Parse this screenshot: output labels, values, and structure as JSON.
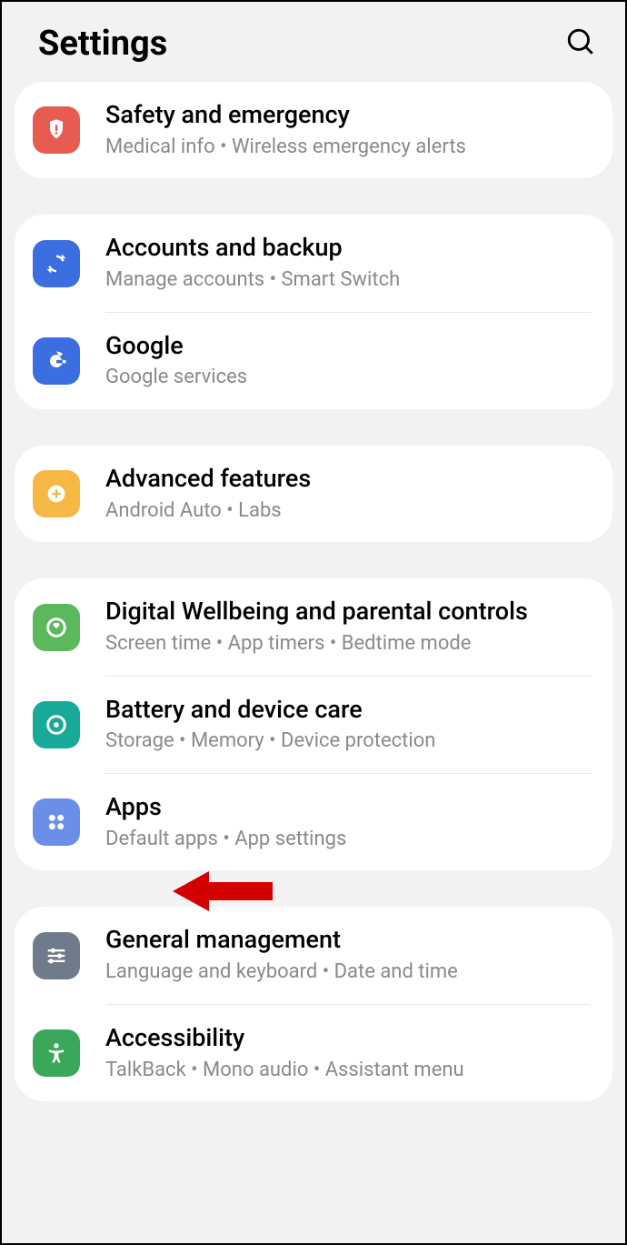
{
  "header": {
    "title": "Settings"
  },
  "groups": [
    {
      "items": [
        {
          "title": "Safety and emergency",
          "subtitle": "Medical info  •  Wireless emergency alerts"
        }
      ]
    },
    {
      "items": [
        {
          "title": "Accounts and backup",
          "subtitle": "Manage accounts  •  Smart Switch"
        },
        {
          "title": "Google",
          "subtitle": "Google services"
        }
      ]
    },
    {
      "items": [
        {
          "title": "Advanced features",
          "subtitle": "Android Auto  •  Labs"
        }
      ]
    },
    {
      "items": [
        {
          "title": "Digital Wellbeing and parental controls",
          "subtitle": "Screen time  •  App timers  •  Bedtime mode"
        },
        {
          "title": "Battery and device care",
          "subtitle": "Storage  •  Memory  •  Device protection"
        },
        {
          "title": "Apps",
          "subtitle": "Default apps  •  App settings"
        }
      ]
    },
    {
      "items": [
        {
          "title": "General management",
          "subtitle": "Language and keyboard  •  Date and time"
        },
        {
          "title": "Accessibility",
          "subtitle": "TalkBack  •  Mono audio  •  Assistant menu"
        }
      ]
    }
  ]
}
